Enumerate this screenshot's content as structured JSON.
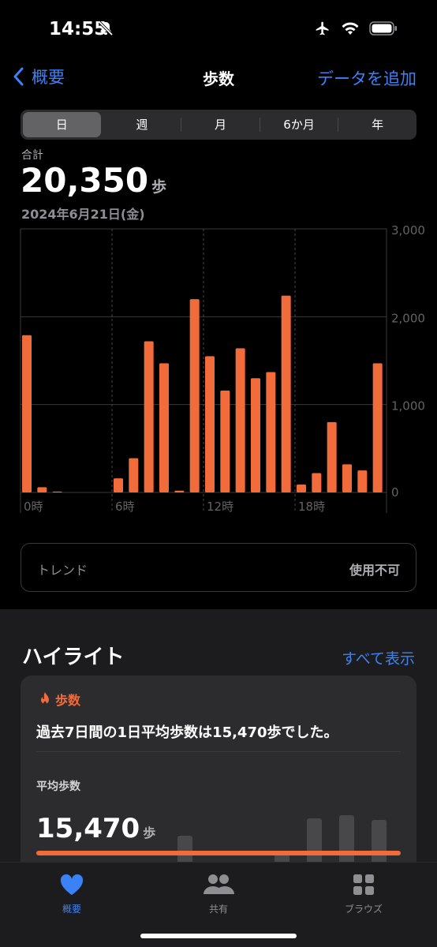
{
  "status": {
    "time": "14:55"
  },
  "nav": {
    "back_label": "概要",
    "title": "歩数",
    "add_label": "データを追加"
  },
  "segments": [
    "日",
    "週",
    "月",
    "6か月",
    "年"
  ],
  "active_segment": "日",
  "summary": {
    "label": "合計",
    "value": "20,350",
    "unit": "歩",
    "date": "2024年6月21日(金)"
  },
  "chart_data": {
    "type": "bar",
    "x": [
      0,
      1,
      2,
      3,
      4,
      5,
      6,
      7,
      8,
      9,
      10,
      11,
      12,
      13,
      14,
      15,
      16,
      17,
      18,
      19,
      20,
      21,
      22,
      23
    ],
    "values": [
      1790,
      60,
      10,
      0,
      0,
      0,
      160,
      390,
      1720,
      1470,
      20,
      2200,
      1550,
      1160,
      1640,
      1300,
      1370,
      2240,
      90,
      220,
      800,
      320,
      250,
      1470
    ],
    "x_tick_labels": [
      "0時",
      "6時",
      "12時",
      "18時"
    ],
    "y_tick_labels": [
      "3,000",
      "2,000",
      "1,000",
      "0"
    ],
    "ylim": [
      0,
      3000
    ],
    "bar_color": "#f26b3a",
    "grid": true
  },
  "trend": {
    "label": "トレンド",
    "value": "使用不可"
  },
  "highlights": {
    "heading": "ハイライト",
    "show_all": "すべて表示",
    "card": {
      "tag": "歩数",
      "message": "過去7日間の1日平均歩数は15,470歩でした。",
      "avg_label": "平均歩数",
      "avg_value": "15,470",
      "avg_unit": "歩",
      "accent": "#f26b3a"
    }
  },
  "tabs": [
    {
      "label": "概要",
      "icon": "heart-icon"
    },
    {
      "label": "共有",
      "icon": "people-icon"
    },
    {
      "label": "ブラウズ",
      "icon": "grid-icon"
    }
  ]
}
